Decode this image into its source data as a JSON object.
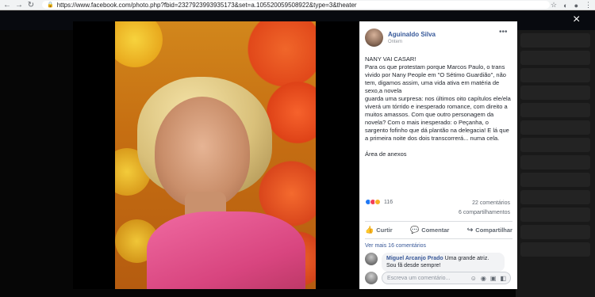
{
  "browser": {
    "url_host": "https://www.facebook.com",
    "url_path": "/photo.php?fbid=2327923993935173&set=a.105520059508922&type=3&theater",
    "back_icon": "arrow-left-icon",
    "forward_icon": "arrow-right-icon",
    "reload_icon": "reload-icon",
    "home_icon": "home-icon"
  },
  "theater": {
    "close_label": "×"
  },
  "post": {
    "author": "Aguinaldo Silva",
    "time": "Ontem",
    "more_label": "•••",
    "text_lines": [
      "NANY VAI CASAR!",
      "Para os que protestam porque Marcos Paulo, o trans vivido por Nany People em \"O Sétimo Guardião\", não tem, digamos assim, uma vida ativa em matéria de sexo,a novela",
      "guarda uma surpresa: nos últimos oito capítulos ele/ela viverá um tórrido e inesperado romance, com direito a muitos amassos. Com que outro personagem da novela? Com o mais inesperado: o Peçanha, o sargento fofinho que dá plantão na delegacia! E lá que a primeira noite dos dois transcorrerá... numa cela."
    ],
    "attachments_label": "Área de anexos",
    "reactions_count": "116",
    "comments_count": "22 comentários",
    "shares_count": "6 compartilhamentos",
    "actions": {
      "like": "Curtir",
      "comment": "Comentar",
      "share": "Compartilhar"
    },
    "see_more_comments": "Ver mais 16 comentários",
    "comment": {
      "author": "Miguel Arcanjo Prado",
      "text": "Uma grande atriz. Sou fã desde sempre!"
    },
    "composer_placeholder": "Escreva um comentário..."
  }
}
